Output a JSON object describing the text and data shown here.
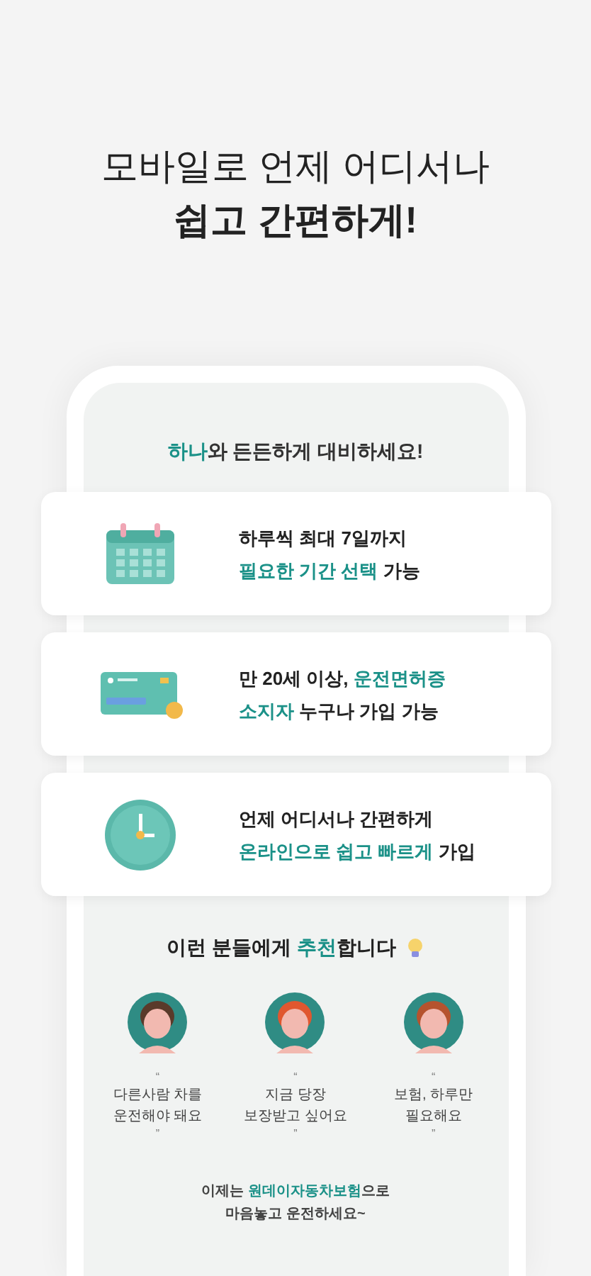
{
  "headline": {
    "line_1": "모바일로 언제 어디서나",
    "line_2": "쉽고 간편하게!"
  },
  "phone": {
    "tagline": [
      {
        "text": "하나",
        "highlight": true
      },
      {
        "text": "와 든든하게 대비하세요!",
        "highlight": false
      }
    ],
    "features": [
      {
        "kind": "calendar",
        "lines": [
          [
            {
              "text": "하루씩 최대 7일까지",
              "highlight": false
            }
          ],
          [
            {
              "text": "필요한 기간 선택",
              "highlight": true
            },
            {
              "text": " 가능",
              "highlight": false
            }
          ]
        ]
      },
      {
        "kind": "card",
        "lines": [
          [
            {
              "text": "만 20세 이상, ",
              "highlight": false
            },
            {
              "text": "운전면허증",
              "highlight": true
            }
          ],
          [
            {
              "text": "소지자",
              "highlight": true
            },
            {
              "text": " 누구나 가입 가능",
              "highlight": false
            }
          ]
        ]
      },
      {
        "kind": "clock",
        "lines": [
          [
            {
              "text": "언제 어디서나 간편하게",
              "highlight": false
            }
          ],
          [
            {
              "text": "온라인으로 쉽고 빠르게",
              "highlight": true
            },
            {
              "text": " 가입",
              "highlight": false
            }
          ]
        ]
      }
    ],
    "recommend_title": [
      {
        "text": "이런 분들에게 ",
        "highlight": false
      },
      {
        "text": "추천",
        "highlight": true
      },
      {
        "text": "합니다",
        "highlight": false
      }
    ],
    "personas": [
      {
        "open_quote": "“",
        "lines": [
          "다른사람 차를",
          "운전해야 돼요"
        ],
        "close_quote": "”"
      },
      {
        "open_quote": "“",
        "lines": [
          "지금 당장",
          "보장받고 싶어요"
        ],
        "close_quote": "”"
      },
      {
        "open_quote": "“",
        "lines": [
          "보험, 하루만",
          "필요해요"
        ],
        "close_quote": "”"
      }
    ],
    "closing": [
      [
        {
          "text": "이제는 ",
          "highlight": false
        },
        {
          "text": "원데이자동차보험",
          "highlight": true
        },
        {
          "text": "으로",
          "highlight": false
        }
      ],
      [
        {
          "text": "마음놓고 운전하세요~",
          "highlight": false
        }
      ]
    ]
  }
}
